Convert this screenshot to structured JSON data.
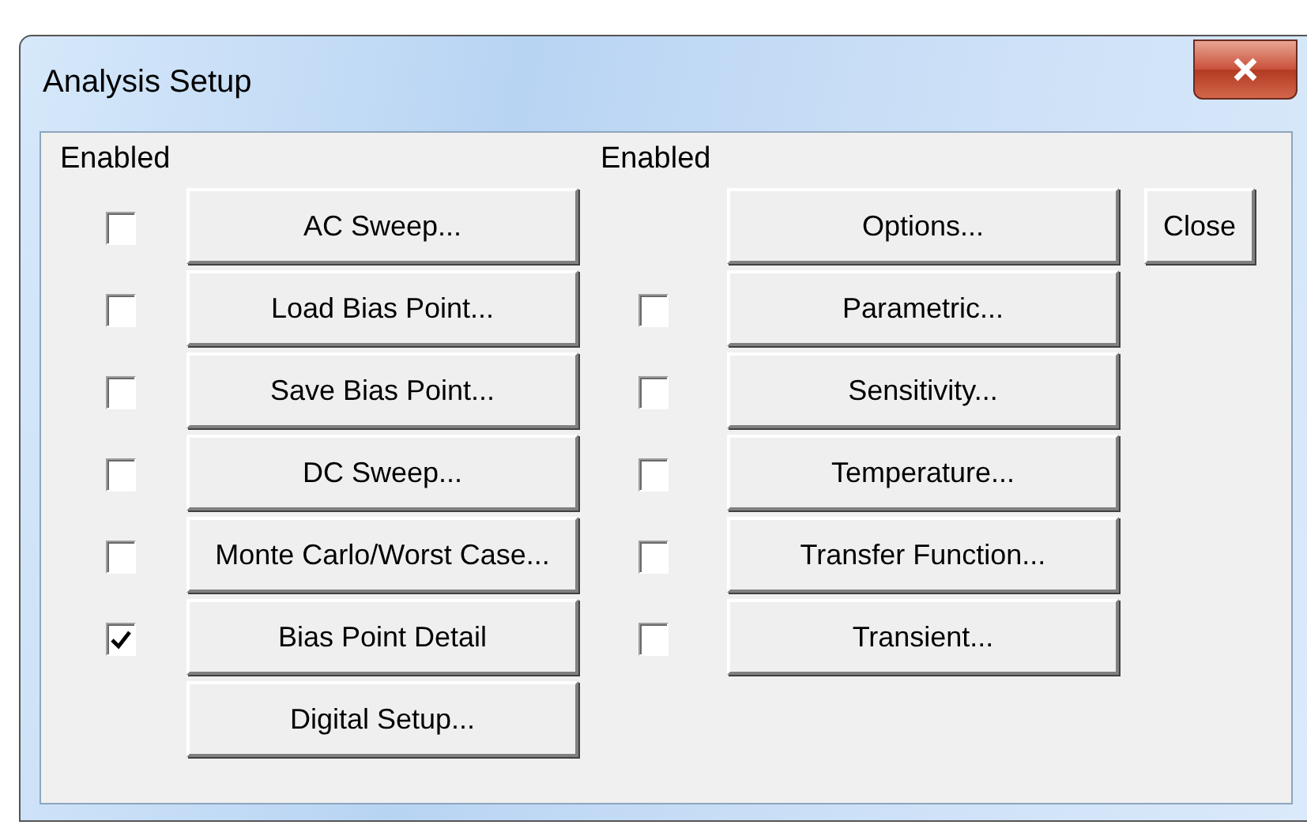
{
  "window": {
    "title": "Analysis Setup"
  },
  "left_column": {
    "header": "Enabled",
    "items": [
      {
        "kind": "checkbox_button",
        "label": "AC Sweep...",
        "checked": false
      },
      {
        "kind": "checkbox_button",
        "label": "Load Bias Point...",
        "checked": false
      },
      {
        "kind": "checkbox_button",
        "label": "Save Bias Point...",
        "checked": false
      },
      {
        "kind": "checkbox_button",
        "label": "DC Sweep...",
        "checked": false
      },
      {
        "kind": "checkbox_button",
        "label": "Monte Carlo/Worst Case...",
        "checked": false
      },
      {
        "kind": "checkbox_button",
        "label": "Bias Point Detail",
        "checked": true
      },
      {
        "kind": "button",
        "label": "Digital Setup..."
      }
    ]
  },
  "right_column": {
    "header": "Enabled",
    "items": [
      {
        "kind": "button",
        "label": "Options..."
      },
      {
        "kind": "checkbox_button",
        "label": "Parametric...",
        "checked": false
      },
      {
        "kind": "checkbox_button",
        "label": "Sensitivity...",
        "checked": false
      },
      {
        "kind": "checkbox_button",
        "label": "Temperature...",
        "checked": false
      },
      {
        "kind": "checkbox_button",
        "label": "Transfer Function...",
        "checked": false
      },
      {
        "kind": "checkbox_button",
        "label": "Transient...",
        "checked": false
      }
    ]
  },
  "close_button": "Close"
}
